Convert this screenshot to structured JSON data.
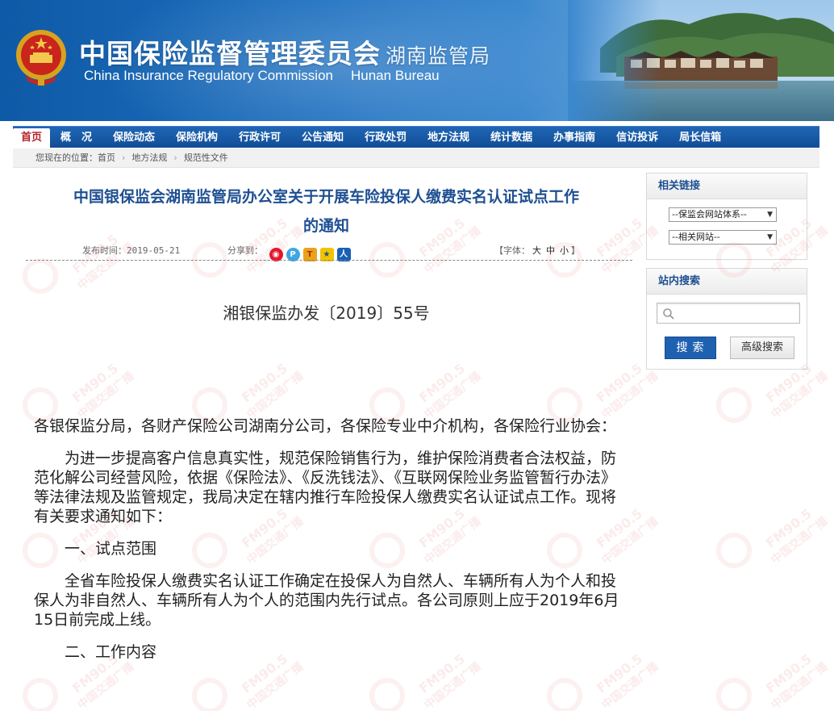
{
  "header": {
    "title_cn": "中国保险监督管理委员会",
    "bureau_cn": "湖南监管局",
    "title_en": "China Insurance Regulatory Commission",
    "bureau_en": "Hunan Bureau"
  },
  "nav": {
    "items": [
      "首页",
      "概　况",
      "保险动态",
      "保险机构",
      "行政许可",
      "公告通知",
      "行政处罚",
      "地方法规",
      "统计数据",
      "办事指南",
      "信访投诉",
      "局长信箱"
    ]
  },
  "breadcrumb": {
    "prefix": "您现在的位置：",
    "items": [
      "首页",
      "地方法规",
      "规范性文件"
    ]
  },
  "article": {
    "title_line1": "中国银保监会湖南监管局办公室关于开展车险投保人缴费实名认证试点工作",
    "title_line2": "的通知",
    "publish_label": "发布时间：",
    "publish_date": "2019-05-21",
    "share_label": "分享到：",
    "font_label": "【字体：",
    "font_large": "大",
    "font_medium": "中",
    "font_small": "小",
    "font_close": "】",
    "doc_number": "湘银保监办发〔2019〕55号",
    "paragraphs": [
      "各银保监分局，各财产保险公司湖南分公司，各保险专业中介机构，各保险行业协会：",
      "为进一步提高客户信息真实性，规范保险销售行为，维护保险消费者合法权益，防范化解公司经营风险，依据《保险法》、《反洗钱法》、《互联网保险业务监管暂行办法》等法律法规及监管规定，我局决定在辖内推行车险投保人缴费实名认证试点工作。现将有关要求通知如下：",
      "一、试点范围",
      "全省车险投保人缴费实名认证工作确定在投保人为自然人、车辆所有人为个人和投保人为非自然人、车辆所有人为个人的范围内先行试点。各公司原则上应于2019年6月15日前完成上线。",
      "二、工作内容"
    ]
  },
  "sidebar": {
    "links_title": "相关链接",
    "select1": "--保监会网站体系--",
    "select2": "--相关网站--",
    "search_title": "站内搜索",
    "search_button": "搜索",
    "advanced_button": "高级搜索"
  },
  "watermark": {
    "fm": "FM90.5",
    "station": "中国交通广播"
  },
  "colors": {
    "nav_blue": "#124d96",
    "title_blue": "#1e4f92",
    "active_red": "#b3242a",
    "search_button": "#1f61b1"
  }
}
